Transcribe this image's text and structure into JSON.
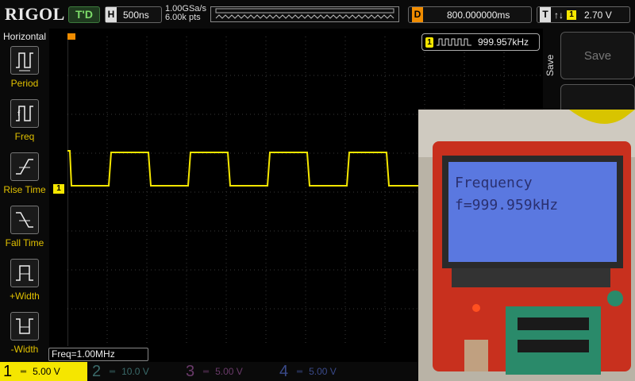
{
  "header": {
    "brand": "RIGOL",
    "trigger_status": "T'D",
    "timebase_tag": "H",
    "timebase": "500ns",
    "sample_rate": "1.00GSa/s",
    "memory_depth": "6.00k pts",
    "delay_tag": "D",
    "delay": "800.000000ms",
    "trigger_tag": "T",
    "trigger_edge": "↑↓",
    "trigger_source": "1",
    "trigger_level": "2.70 V"
  },
  "left_menu": {
    "title": "Horizontal",
    "items": [
      {
        "label": "Period",
        "icon": "period-icon"
      },
      {
        "label": "Freq",
        "icon": "frequency-icon"
      },
      {
        "label": "Rise Time",
        "icon": "rise-time-icon"
      },
      {
        "label": "Fall Time",
        "icon": "fall-time-icon"
      },
      {
        "label": "+Width",
        "icon": "positive-width-icon"
      },
      {
        "label": "-Width",
        "icon": "negative-width-icon"
      }
    ]
  },
  "measurement": {
    "channel": "1",
    "value": "999.957kHz"
  },
  "right_menu": {
    "group_label": "Save",
    "save_button": "Save"
  },
  "freq_readout": "Freq=1.00MHz",
  "channels": [
    {
      "num": "1",
      "scale": "5.00 V",
      "color": "#f5e600"
    },
    {
      "num": "2",
      "scale": "10.0 V",
      "color": "#00b4c8"
    },
    {
      "num": "3",
      "scale": "5.00 V",
      "color": "#c040c0"
    },
    {
      "num": "4",
      "scale": "5.00 V",
      "color": "#2060e0"
    }
  ],
  "photo": {
    "lcd_line1": "Frequency",
    "lcd_line2": "f=999.959kHz"
  },
  "colors": {
    "waveform": "#f5e600",
    "accent_orange": "#f08c00"
  }
}
